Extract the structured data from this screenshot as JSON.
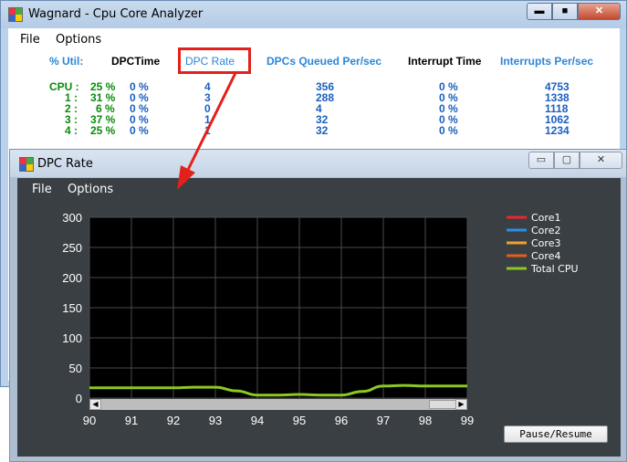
{
  "main_window": {
    "title": "Wagnard - Cpu Core Analyzer",
    "controls": {
      "minimize": "▬",
      "maximize": "■",
      "close": "✕"
    },
    "menu": [
      "File",
      "Options"
    ],
    "headers": {
      "util": "% Util:",
      "dpctime": "DPCTime",
      "dpcrate": "DPC Rate",
      "dpcqueued": "DPCs Queued Per/sec",
      "interrupt_time": "Interrupt Time",
      "interrupts": "Interrupts Per/sec"
    },
    "rows": [
      {
        "label": "CPU :",
        "util": "25 %",
        "dpctime": "0 %",
        "dpcrate": "4",
        "queued": "356",
        "inttime": "0 %",
        "intsec": "4753"
      },
      {
        "label": "1 :",
        "util": "31 %",
        "dpctime": "0 %",
        "dpcrate": "3",
        "queued": "288",
        "inttime": "0 %",
        "intsec": "1338"
      },
      {
        "label": "2 :",
        "util": "6 %",
        "dpctime": "0 %",
        "dpcrate": "0",
        "queued": "4",
        "inttime": "0 %",
        "intsec": "1118"
      },
      {
        "label": "3 :",
        "util": "37 %",
        "dpctime": "0 %",
        "dpcrate": "1",
        "queued": "32",
        "inttime": "0 %",
        "intsec": "1062"
      },
      {
        "label": "4 :",
        "util": "25 %",
        "dpctime": "0 %",
        "dpcrate": "1",
        "queued": "32",
        "inttime": "0 %",
        "intsec": "1234"
      }
    ]
  },
  "dpc_window": {
    "title": "DPC Rate",
    "controls": {
      "minimize": "▭",
      "maximize": "▢",
      "close": "✕"
    },
    "menu": [
      "File",
      "Options"
    ],
    "pause_button": "Pause/Resume",
    "scroll": {
      "left": "◀",
      "right": "▶"
    }
  },
  "colors": {
    "highlight": "#e3201b",
    "core1": "#e8282b",
    "core2": "#2d8ee8",
    "core3": "#f0a030",
    "core4": "#e0601a",
    "total": "#8cc821"
  },
  "chart_data": {
    "type": "line",
    "x": [
      90,
      90.5,
      91,
      91.5,
      92,
      92.5,
      93,
      93.5,
      94,
      94.5,
      95,
      95.5,
      96,
      96.5,
      97,
      97.5,
      98,
      98.5,
      99
    ],
    "xlim": [
      90,
      99
    ],
    "ylim": [
      0,
      300
    ],
    "x_ticks": [
      "90",
      "91",
      "92",
      "93",
      "94",
      "95",
      "96",
      "97",
      "98",
      "99"
    ],
    "y_ticks": [
      "300",
      "250",
      "200",
      "150",
      "100",
      "50",
      "0"
    ],
    "grid": true,
    "legend_position": "right",
    "series": [
      {
        "name": "Core1",
        "color": "#e8282b",
        "values": []
      },
      {
        "name": "Core2",
        "color": "#2d8ee8",
        "values": []
      },
      {
        "name": "Core3",
        "color": "#f0a030",
        "values": []
      },
      {
        "name": "Core4",
        "color": "#e0601a",
        "values": []
      },
      {
        "name": "Total CPU",
        "color": "#8cc821",
        "values": [
          17,
          17,
          17,
          17,
          17,
          18,
          18,
          12,
          5,
          5,
          6,
          5,
          5,
          11,
          20,
          21,
          20,
          20,
          20
        ]
      }
    ]
  }
}
